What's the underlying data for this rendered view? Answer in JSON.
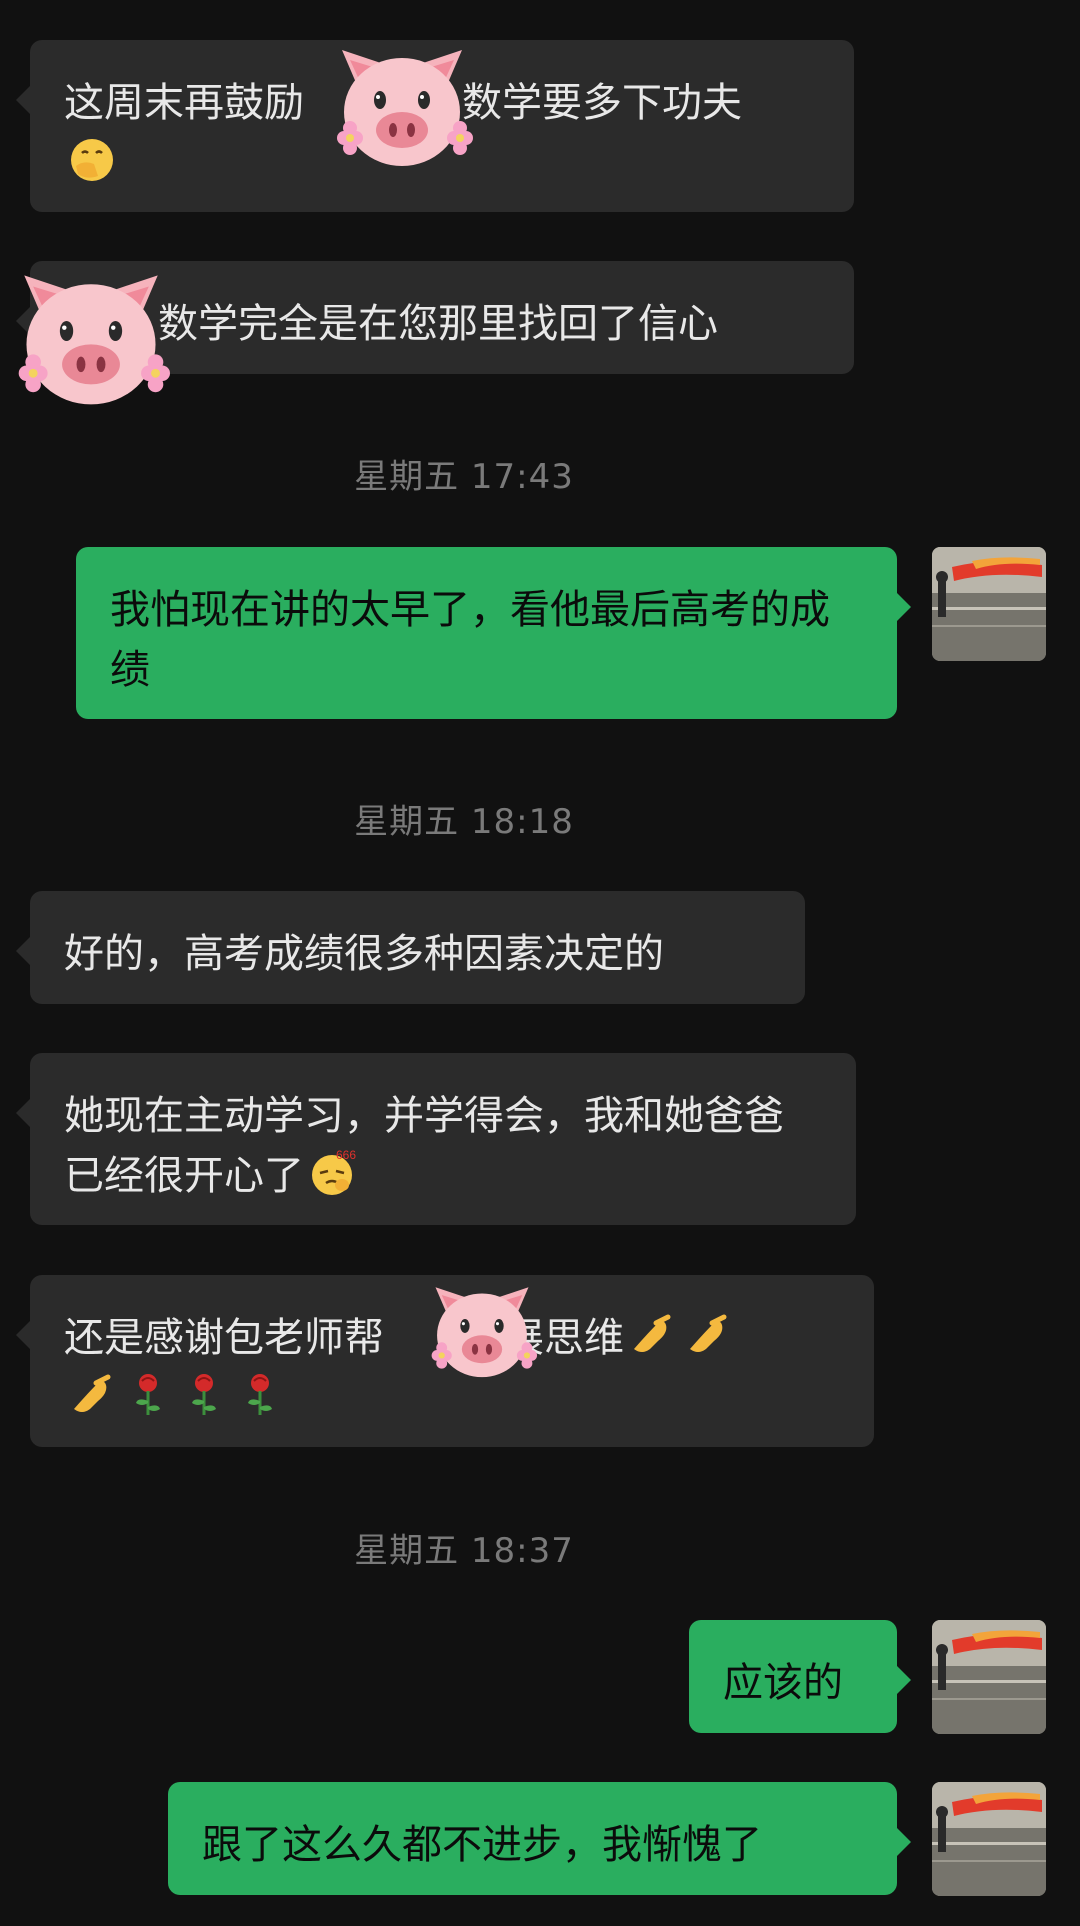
{
  "messages": [
    {
      "id": "m1",
      "direction": "incoming",
      "text_before": "这周末再鼓励",
      "text_after": "数学要多下功夫",
      "emoji": "face-with-hand-over-mouth"
    },
    {
      "id": "m2",
      "direction": "incoming",
      "text": "数学完全是在您那里找回了信心"
    },
    {
      "id": "t1",
      "type": "timestamp",
      "text": "星期五 17:43"
    },
    {
      "id": "m3",
      "direction": "outgoing",
      "text": "我怕现在讲的太早了，看他最后高考的成绩"
    },
    {
      "id": "t2",
      "type": "timestamp",
      "text": "星期五 18:18"
    },
    {
      "id": "m4",
      "direction": "incoming",
      "text": "好的，高考成绩很多种因素决定的"
    },
    {
      "id": "m5",
      "direction": "incoming",
      "text": "她现在主动学习，并学得会，我和她爸爸已经很开心了",
      "emoji": "666-face"
    },
    {
      "id": "m6",
      "direction": "incoming",
      "text_before": "还是感谢包老师帮",
      "text_after": "拓展思维",
      "emoji_tail": [
        "ok-hand",
        "ok-hand",
        "ok-hand",
        "rose",
        "rose",
        "rose"
      ]
    },
    {
      "id": "t3",
      "type": "timestamp",
      "text": "星期五 18:37"
    },
    {
      "id": "m7",
      "direction": "outgoing",
      "text": "应该的"
    },
    {
      "id": "m8",
      "direction": "outgoing",
      "text": "跟了这么久都不进步，我惭愧了"
    }
  ],
  "colors": {
    "background": "#111111",
    "incoming_bubble": "#2b2b2b",
    "outgoing_bubble": "#2aae5f",
    "timestamp": "#7a7a7a"
  },
  "icons": {
    "privacy_sticker": "pig-face-icon",
    "self_avatar": "sunset-beach-avatar"
  }
}
